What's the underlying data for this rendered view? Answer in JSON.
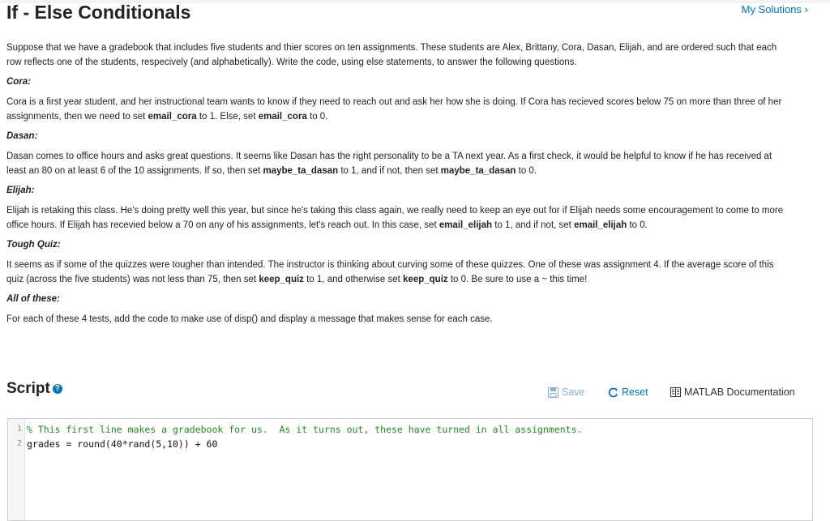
{
  "header": {
    "title": "If - Else Conditionals",
    "my_solutions": "My Solutions",
    "chevron": "›"
  },
  "problem": {
    "intro": "Suppose that we have a gradebook that includes five students and thier scores on ten assignments.  These students are Alex, Brittany, Cora, Dasan, Elijah, and are ordered such that each row reflects one of the students, respecively (and alphabetically).  Write the code, using else statements, to answer the following questions.",
    "sections": [
      {
        "heading": "Cora:",
        "parts": [
          "Cora is a first year student, and her instructional team wants to know if they need to reach out and ask her how she is doing.  If Cora has recieved scores below 75 on more than three of her assignments, then we need to set ",
          "email_cora",
          " to 1.  Else, set ",
          "email_cora",
          " to 0."
        ]
      },
      {
        "heading": "Dasan:",
        "parts": [
          "Dasan comes to office hours and asks great questions.  It seems like Dasan has the right personality to be a TA next year.  As a first check, it would be helpful to know if he has received at least an 80 on at least 6 of the 10 assignments.  If so, then set ",
          "maybe_ta_dasan",
          " to 1, and if not, then set ",
          "maybe_ta_dasan",
          " to 0."
        ]
      },
      {
        "heading": "Elijah:",
        "parts": [
          "Elijah is retaking this class.  He's doing pretty well this year, but since he's taking this class again, we really need to keep an eye out for if Elijah needs some encouragement to come to more office hours.  If Elijah has recevied below a 70 on any of his assignments, let's reach out. In this case, set ",
          "email_elijah",
          " to 1, and if not, set ",
          "email_elijah",
          " to 0."
        ]
      },
      {
        "heading": "Tough Quiz:",
        "parts": [
          "It seems as if some of the quizzes were tougher than intended.  The instructor is thinking about curving some of these quizzes.  One of these was assignment 4.  If the average score of this quiz (across the five students) was not less than 75, then set ",
          "keep_quiz",
          " to 1, and otherwise set ",
          "keep_quiz",
          " to 0.  Be sure to use a ~ this time!"
        ]
      },
      {
        "heading": "All of these:",
        "parts": [
          "For each of these 4 tests, add the code to make use of disp() and display a message that makes sense for each case."
        ]
      }
    ]
  },
  "script": {
    "title": "Script",
    "help_glyph": "?",
    "toolbar": {
      "save": "Save",
      "reset": "Reset",
      "documentation": "MATLAB Documentation"
    },
    "lines": [
      {
        "num": "1",
        "text": "% This first line makes a gradebook for us.  As it turns out, these have turned in all assignments."
      },
      {
        "num": "2",
        "text": "grades = round(40*rand(5,10)) + 60"
      }
    ]
  },
  "colors": {
    "link": "#0076c0",
    "comment": "#228b22",
    "disabled": "#8ab0d0"
  }
}
